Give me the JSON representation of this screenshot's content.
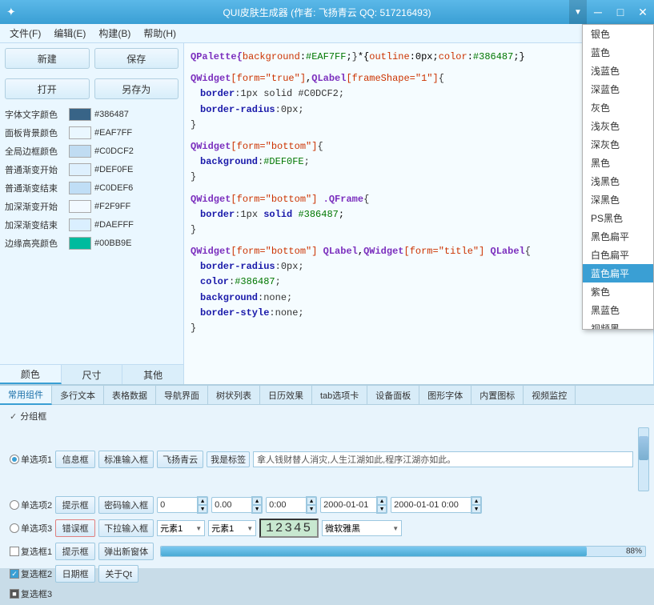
{
  "titlebar": {
    "title": "QUI皮肤生成器 (作者: 飞扬青云  QQ: 517216493)",
    "icon": "✦",
    "dropdown_arrow": "▼",
    "minimize": "─",
    "maximize": "□",
    "close": "✕"
  },
  "menubar": {
    "items": [
      {
        "label": "文件(F)"
      },
      {
        "label": "编辑(E)"
      },
      {
        "label": "构建(B)"
      },
      {
        "label": "帮助(H)"
      }
    ]
  },
  "left_panel": {
    "buttons": {
      "new": "新建",
      "save": "保存",
      "open": "打开",
      "save_as": "另存为"
    },
    "colors": [
      {
        "label": "字体文字颜色",
        "hex": "#386487",
        "color": "#386487"
      },
      {
        "label": "面板背景颜色",
        "hex": "#EAF7FF",
        "color": "#EAF7FF"
      },
      {
        "label": "全局边框颜色",
        "hex": "#C0DCF2",
        "color": "#C0DCF2"
      },
      {
        "label": "普通渐变开始",
        "hex": "#DEF0FE",
        "color": "#DEF0FE"
      },
      {
        "label": "普通渐变结束",
        "hex": "#C0DEF6",
        "color": "#C0DEF6"
      },
      {
        "label": "加深渐变开始",
        "hex": "#F2F9FF",
        "color": "#F2F9FF"
      },
      {
        "label": "加深渐变结束",
        "hex": "#DAEFFF",
        "color": "#DAEFFF"
      },
      {
        "label": "边缘高亮颜色",
        "hex": "#00BB9E",
        "color": "#00BB9E"
      }
    ],
    "tabs": [
      {
        "label": "颜色",
        "active": true
      },
      {
        "label": "尺寸",
        "active": false
      },
      {
        "label": "其他",
        "active": false
      }
    ]
  },
  "code_panel": {
    "blocks": [
      {
        "lines": [
          {
            "type": "selector",
            "text": "QPalette{"
          },
          {
            "type": "mixed",
            "parts": [
              {
                "t": "attr",
                "v": "background"
              },
              {
                "t": "plain",
                "v": ":"
              },
              {
                "t": "hex",
                "v": "#EAF7FF"
              },
              {
                "t": "plain",
                "v": ";"
              },
              {
                "t": "plain",
                "v": "}*{"
              },
              {
                "t": "attr",
                "v": "outline"
              },
              {
                "t": "plain",
                "v": ":0px;"
              },
              {
                "t": "attr",
                "v": "color"
              },
              {
                "t": "plain",
                "v": ":"
              },
              {
                "t": "hex",
                "v": "#386487"
              },
              {
                "t": "plain",
                "v": ";}"
              }
            ]
          }
        ]
      },
      {
        "lines": [
          {
            "type": "selector",
            "text": "QWidget[form=\"true\"],QLabel[frameShape=\"1\"]{"
          },
          {
            "type": "indent",
            "text": "border:1px solid #C0DCF2;"
          },
          {
            "type": "indent",
            "text": "border-radius:0px;"
          },
          {
            "type": "plain",
            "text": "}"
          }
        ]
      },
      {
        "lines": [
          {
            "type": "selector",
            "text": "QWidget[form=\"bottom\"]{"
          },
          {
            "type": "indent_prop",
            "prop": "background",
            "val": ":#DEF0FE;"
          },
          {
            "type": "plain",
            "text": "}"
          }
        ]
      },
      {
        "lines": [
          {
            "type": "selector",
            "text": "QWidget[form=\"bottom\"] .QFrame{"
          },
          {
            "type": "indent",
            "text": "border:1px solid #386487;"
          },
          {
            "type": "plain",
            "text": "}"
          }
        ]
      },
      {
        "lines": [
          {
            "type": "selector",
            "text": "QWidget[form=\"bottom\"] QLabel,QWidget[form=\"title\"] QLabel{"
          },
          {
            "type": "indent_prop",
            "prop": "border-radius",
            "val": ":0px;"
          },
          {
            "type": "indent_prop",
            "prop": "color",
            "val": ":#386487;"
          },
          {
            "type": "indent_prop",
            "prop": "background",
            "val": ":none;"
          },
          {
            "type": "indent_prop",
            "prop": "border-style",
            "val": ":none;"
          },
          {
            "type": "plain",
            "text": "}"
          }
        ]
      }
    ]
  },
  "dropdown": {
    "items": [
      {
        "label": "银色",
        "highlighted": false
      },
      {
        "label": "蓝色",
        "highlighted": false
      },
      {
        "label": "浅蓝色",
        "highlighted": false
      },
      {
        "label": "深蓝色",
        "highlighted": false
      },
      {
        "label": "灰色",
        "highlighted": false
      },
      {
        "label": "浅灰色",
        "highlighted": false
      },
      {
        "label": "深灰色",
        "highlighted": false
      },
      {
        "label": "黑色",
        "highlighted": false
      },
      {
        "label": "浅黑色",
        "highlighted": false
      },
      {
        "label": "深黑色",
        "highlighted": false
      },
      {
        "label": "PS黑色",
        "highlighted": false
      },
      {
        "label": "黑色扁平",
        "highlighted": false
      },
      {
        "label": "白色扁平",
        "highlighted": false
      },
      {
        "label": "蓝色扁平",
        "highlighted": true
      },
      {
        "label": "紫色",
        "highlighted": false
      },
      {
        "label": "黑蓝色",
        "highlighted": false
      },
      {
        "label": "视频黑",
        "highlighted": false
      }
    ]
  },
  "component_tabs": [
    {
      "label": "常用组件",
      "active": true
    },
    {
      "label": "多行文本",
      "active": false
    },
    {
      "label": "表格数据",
      "active": false
    },
    {
      "label": "导航界面",
      "active": false
    },
    {
      "label": "树状列表",
      "active": false
    },
    {
      "label": "日历效果",
      "active": false
    },
    {
      "label": "tab选项卡",
      "active": false
    },
    {
      "label": "设备面板",
      "active": false
    },
    {
      "label": "图形字体",
      "active": false
    },
    {
      "label": "内置图标",
      "active": false
    },
    {
      "label": "视频监控",
      "active": false
    }
  ],
  "components": {
    "group_title": "分组框",
    "radios": [
      {
        "label": "单选项1",
        "checked": true
      },
      {
        "label": "单选项2",
        "checked": false
      },
      {
        "label": "单选项3",
        "checked": false
      }
    ],
    "checkboxes": [
      {
        "label": "复选框1",
        "state": "unchecked"
      },
      {
        "label": "复选框2",
        "state": "checked"
      },
      {
        "label": "复选框3",
        "state": "square"
      }
    ],
    "buttons": [
      {
        "label": "信息框"
      },
      {
        "label": "标准输入框"
      },
      {
        "label": "飞扬青云"
      },
      {
        "label": "我是标签"
      },
      {
        "long_text": "拿人钱财替人消灾,人生江湖如此,程序江湖亦如此。"
      }
    ],
    "row2_buttons": [
      {
        "label": "提示框"
      },
      {
        "label": "密码输入框"
      }
    ],
    "row2_inputs": [
      {
        "value": "0"
      },
      {
        "value": "0.00"
      },
      {
        "value": "0:00"
      },
      {
        "value": "2000-01-01"
      },
      {
        "value": "2000-01-01 0:00"
      }
    ],
    "row3_buttons": [
      {
        "label": "错误框"
      },
      {
        "label": "下拉输入框"
      }
    ],
    "row3_combos": [
      {
        "value": "元素1"
      },
      {
        "value": "元素1"
      }
    ],
    "lcd_value": "12345",
    "combo_font": "微软雅黑",
    "row4_buttons": [
      {
        "label": "提示框"
      },
      {
        "label": "弹出新窗体"
      }
    ],
    "progress": {
      "value": 88,
      "label": "88%"
    },
    "bottom_buttons": [
      {
        "label": "日期框"
      },
      {
        "label": "关于Qt"
      }
    ]
  }
}
